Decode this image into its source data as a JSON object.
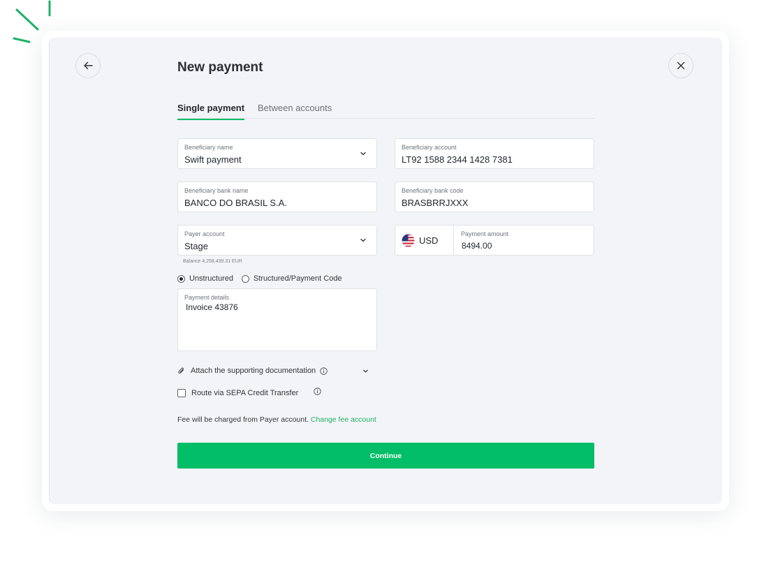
{
  "header": {
    "title": "New payment"
  },
  "tabs": [
    {
      "label": "Single payment",
      "active": true
    },
    {
      "label": "Between accounts",
      "active": false
    }
  ],
  "form": {
    "beneficiary_name": {
      "label": "Beneficiary name",
      "value": "Swift payment"
    },
    "beneficiary_account": {
      "label": "Beneficiary account",
      "value": "LT92 1588 2344 1428 7381"
    },
    "beneficiary_bank_name": {
      "label": "Beneficiary bank name",
      "value": "BANCO DO BRASIL S.A."
    },
    "beneficiary_bank_code": {
      "label": "Beneficiary bank code",
      "value": "BRASBRRJXXX"
    },
    "payer_account": {
      "label": "Payer account",
      "value": "Stage",
      "balance": "Balance 4,258,439.31 EUR"
    },
    "currency": "USD",
    "payment_amount": {
      "label": "Payment amount",
      "value": "8494.00"
    },
    "remittance_type": {
      "options": [
        "Unstructured",
        "Structured/Payment Code"
      ],
      "selected": "Unstructured"
    },
    "payment_details": {
      "label": "Payment details",
      "value": "Invoice 43876"
    },
    "attach_label": "Attach the supporting documentation",
    "sepa_label": "Route via SEPA Credit Transfer",
    "fee_text": "Fee will be charged from Payer account.",
    "fee_link": "Change fee account",
    "continue_label": "Continue"
  },
  "icons": {
    "back": "arrow-left-icon",
    "close": "close-icon",
    "dropdown": "chevron-down-icon",
    "flag": "us-flag-icon",
    "attach": "paperclip-icon",
    "info": "info-icon"
  },
  "colors": {
    "accent": "#00bd68",
    "link": "#1fb06a",
    "panel_background": "#f3f4f7",
    "text": "#22272b"
  }
}
